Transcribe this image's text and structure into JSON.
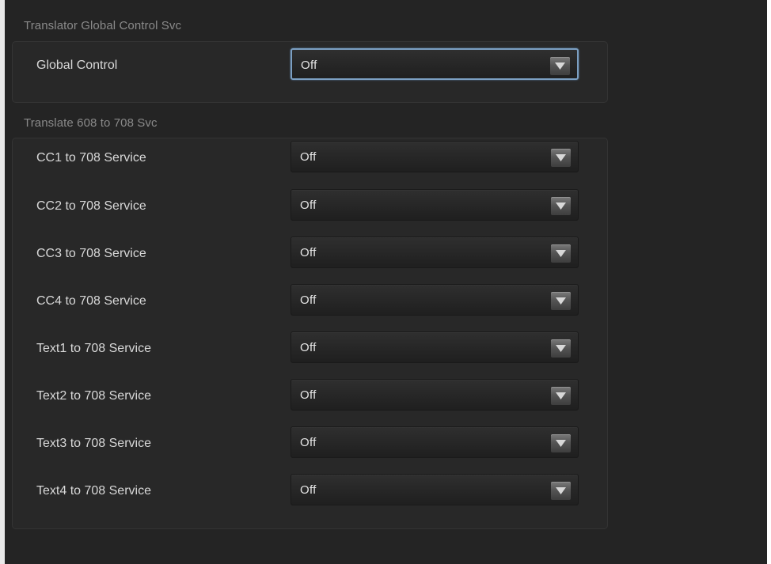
{
  "global_section": {
    "title": "Translator Global Control Svc",
    "rows": [
      {
        "label": "Global Control",
        "value": "Off"
      }
    ]
  },
  "translate_section": {
    "title": "Translate 608 to 708 Svc",
    "rows": [
      {
        "label": "CC1 to 708 Service",
        "value": "Off"
      },
      {
        "label": "CC2 to 708 Service",
        "value": "Off"
      },
      {
        "label": "CC3 to 708 Service",
        "value": "Off"
      },
      {
        "label": "CC4 to 708 Service",
        "value": "Off"
      },
      {
        "label": "Text1 to 708 Service",
        "value": "Off"
      },
      {
        "label": "Text2 to 708 Service",
        "value": "Off"
      },
      {
        "label": "Text3 to 708 Service",
        "value": "Off"
      },
      {
        "label": "Text4 to 708 Service",
        "value": "Off"
      }
    ]
  },
  "icons": {
    "dropdown": "chevron-down-icon"
  },
  "colors": {
    "panel_background": "#242424",
    "group_background": "#282828",
    "focus_border": "#7b9fc2",
    "label_text": "#d8d8d8",
    "section_title_text": "#8a8a8a"
  }
}
